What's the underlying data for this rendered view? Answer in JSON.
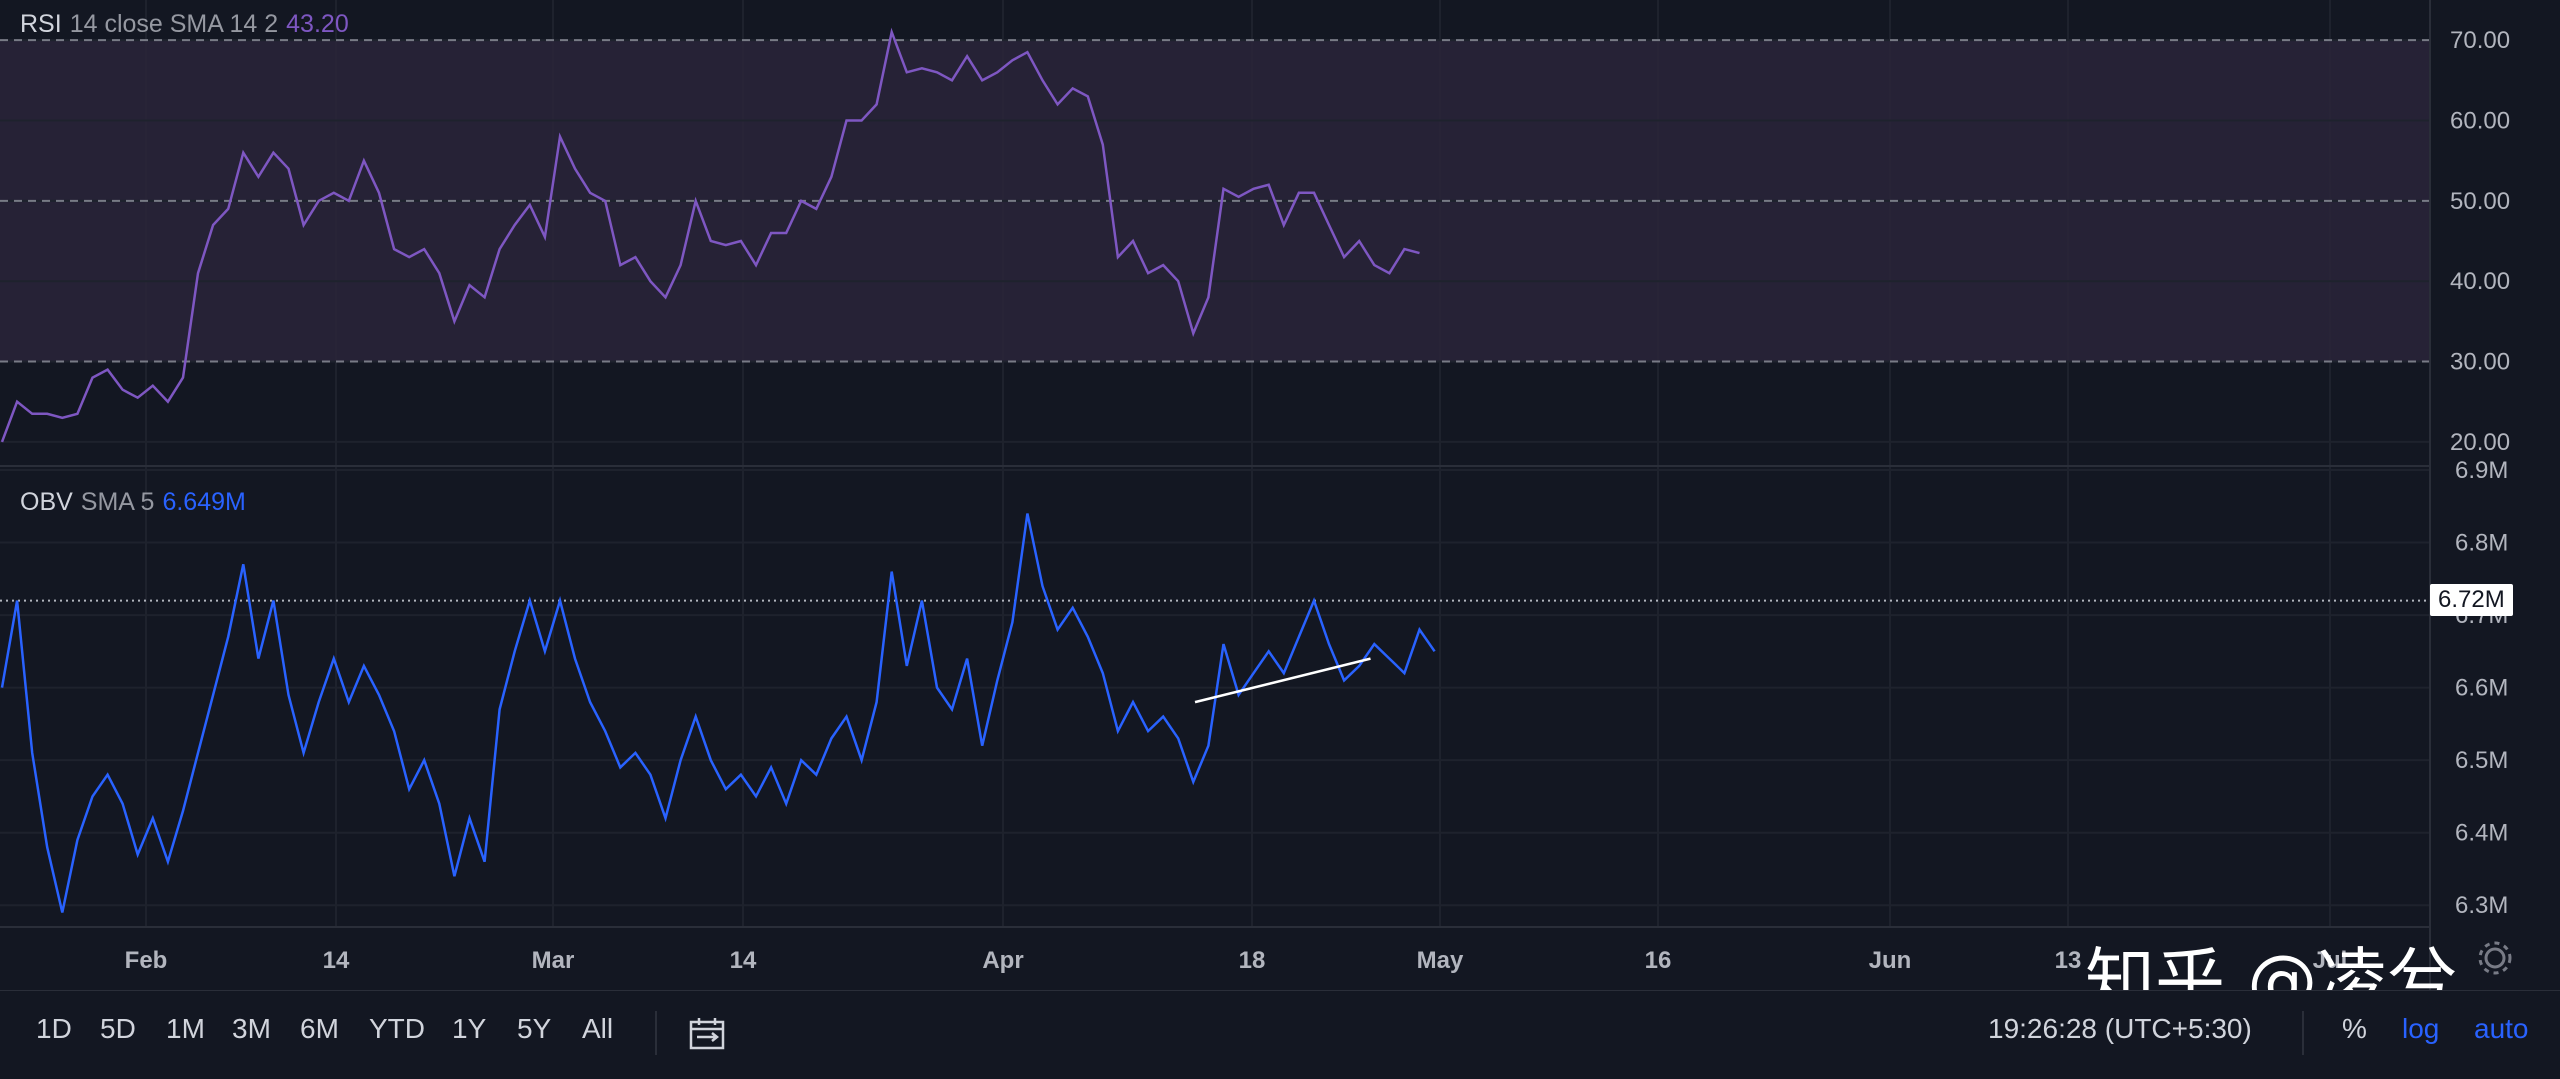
{
  "colors": {
    "background": "#131722",
    "rsi_line": "#7e57c2",
    "rsi_band": "#2a2439",
    "obv_line": "#2962ff",
    "grid": "#1e222d",
    "trendline": "#ffffff"
  },
  "legends": {
    "rsi": {
      "name": "RSI",
      "params": "14 close SMA 14 2",
      "value": "43.20"
    },
    "obv": {
      "name": "OBV",
      "params": "SMA 5",
      "value": "6.649M"
    }
  },
  "price_badge": "6.72M",
  "watermark": "知乎 @凌兮",
  "toolbar": {
    "timeframes": [
      "1D",
      "5D",
      "1M",
      "3M",
      "6M",
      "YTD",
      "1Y",
      "5Y",
      "All"
    ],
    "date_range_icon": "calendar-range-icon",
    "time": "19:26:28 (UTC+5:30)",
    "percent": "%",
    "log": "log",
    "auto": "auto"
  },
  "chart_data": [
    {
      "type": "line",
      "title": "RSI 14 close SMA 14 2",
      "ylim": [
        17,
        75
      ],
      "yticks": [
        "70.00",
        "60.00",
        "50.00",
        "40.00",
        "30.00",
        "20.00"
      ],
      "yticks_values": [
        70,
        60,
        50,
        40,
        30,
        20
      ],
      "bands": {
        "upper": 70,
        "middle": 50,
        "lower": 30
      },
      "x_index": [
        0,
        1,
        2,
        3,
        4,
        5,
        6,
        7,
        8,
        9,
        10,
        11,
        12,
        13,
        14,
        15,
        16,
        17,
        18,
        19,
        20,
        21,
        22,
        23,
        24,
        25,
        26,
        27,
        28,
        29,
        30,
        31,
        32,
        33,
        34,
        35,
        36,
        37,
        38,
        39,
        40,
        41,
        42,
        43,
        44,
        45,
        46,
        47,
        48,
        49,
        50,
        51,
        52,
        53,
        54,
        55,
        56,
        57,
        58,
        59,
        60,
        61,
        62,
        63,
        64,
        65,
        66,
        67,
        68,
        69,
        70,
        71,
        72,
        73,
        74,
        75,
        76,
        77,
        78,
        79,
        80,
        81,
        82,
        83,
        84,
        85,
        86,
        87,
        88,
        89,
        90,
        91
      ],
      "series": [
        {
          "name": "RSI",
          "values": [
            20,
            25,
            23.5,
            23.5,
            23,
            23.5,
            28,
            29,
            26.5,
            25.5,
            27,
            25,
            28,
            41,
            47,
            49,
            56,
            53,
            56,
            54,
            47,
            50,
            51,
            50,
            55,
            51,
            44,
            43,
            44,
            41,
            35,
            39.5,
            38,
            44,
            47,
            49.5,
            45.5,
            58,
            54,
            51,
            50,
            42,
            43,
            40,
            38,
            42,
            50,
            45,
            44.5,
            45,
            42,
            46,
            46,
            50,
            49,
            53,
            60,
            60,
            62,
            71,
            66,
            66.5,
            66,
            65,
            68,
            65,
            66,
            67.5,
            68.5,
            65,
            62,
            64,
            63,
            57,
            43,
            45,
            41,
            42,
            40,
            33.5,
            38,
            51.5,
            50.5,
            51.5,
            52,
            47,
            51,
            51,
            47,
            43,
            45,
            42,
            41,
            44,
            43.5
          ]
        }
      ]
    },
    {
      "type": "line",
      "title": "OBV SMA 5",
      "ylim": [
        6.27,
        6.9
      ],
      "yticks": [
        "6.9M",
        "6.8M",
        "6.7M",
        "6.6M",
        "6.5M",
        "6.4M",
        "6.3M"
      ],
      "yticks_values": [
        6.9,
        6.8,
        6.7,
        6.6,
        6.5,
        6.4,
        6.3
      ],
      "price_line": 6.72,
      "series": [
        {
          "name": "OBV",
          "values": [
            6.6,
            6.72,
            6.51,
            6.38,
            6.29,
            6.39,
            6.45,
            6.48,
            6.44,
            6.37,
            6.42,
            6.36,
            6.43,
            6.51,
            6.59,
            6.67,
            6.77,
            6.64,
            6.72,
            6.59,
            6.51,
            6.58,
            6.64,
            6.58,
            6.63,
            6.59,
            6.54,
            6.46,
            6.5,
            6.44,
            6.34,
            6.42,
            6.36,
            6.57,
            6.65,
            6.72,
            6.65,
            6.72,
            6.64,
            6.58,
            6.54,
            6.49,
            6.51,
            6.48,
            6.42,
            6.5,
            6.56,
            6.5,
            6.46,
            6.48,
            6.45,
            6.49,
            6.44,
            6.5,
            6.48,
            6.53,
            6.56,
            6.5,
            6.58,
            6.76,
            6.63,
            6.72,
            6.6,
            6.57,
            6.64,
            6.52,
            6.61,
            6.69,
            6.84,
            6.74,
            6.68,
            6.71,
            6.67,
            6.62,
            6.54,
            6.58,
            6.54,
            6.56,
            6.53,
            6.47,
            6.52,
            6.66,
            6.59,
            6.62,
            6.65,
            6.62,
            6.67,
            6.72,
            6.66,
            6.61,
            6.63,
            6.66,
            6.64,
            6.62,
            6.68,
            6.65
          ]
        }
      ],
      "trendline": {
        "x": [
          91,
          106
        ],
        "y": [
          6.58,
          6.64
        ]
      }
    }
  ],
  "x_axis": {
    "labels": [
      "Feb",
      "14",
      "Mar",
      "14",
      "Apr",
      "18",
      "May",
      "16",
      "Jun",
      "13",
      "Jul"
    ]
  }
}
